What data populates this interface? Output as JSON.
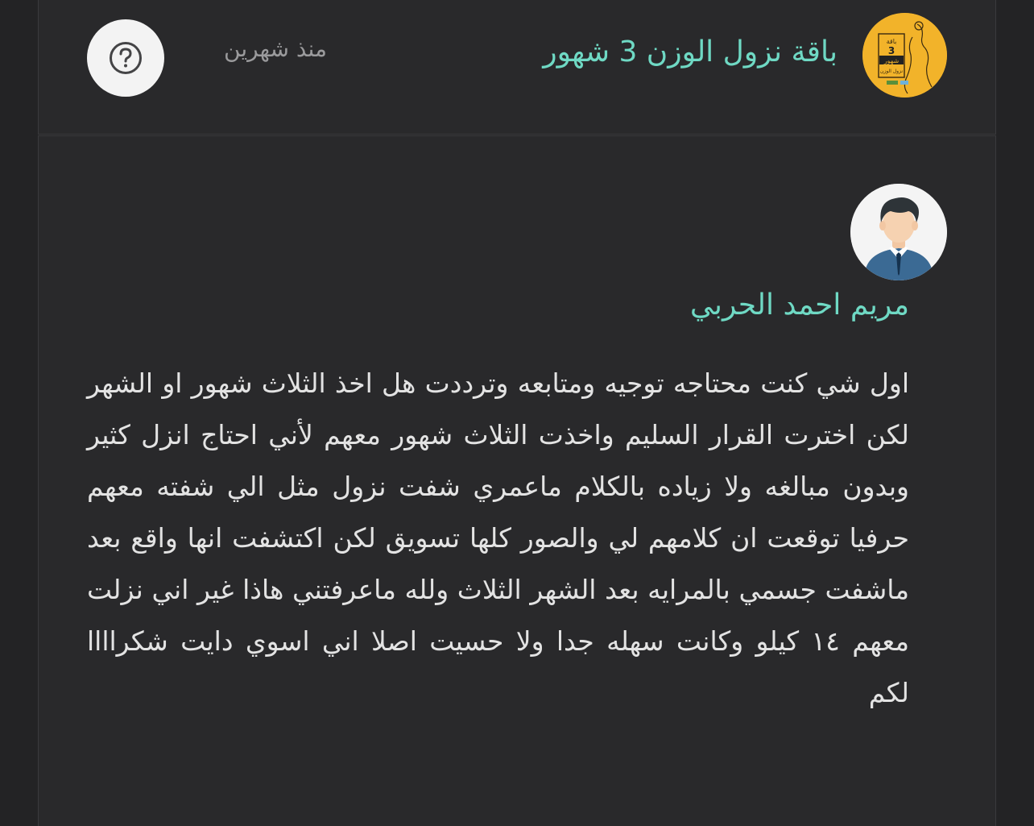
{
  "product": {
    "title": "باقة نزول الوزن 3 شهور",
    "thumbnail_icon": "product-package-image",
    "thumbnail_text": {
      "top": "باقة",
      "number": "3",
      "middle": "شهور",
      "bottom": "نزول الوزن"
    }
  },
  "meta": {
    "time_ago": "منذ شهرين"
  },
  "help": {
    "icon": "question-mark-icon",
    "glyph": "?"
  },
  "review": {
    "avatar_icon": "user-avatar-icon",
    "reviewer_name": "مريم احمد الحربي",
    "text": "اول شي كنت محتاجه توجيه ومتابعه وترددت هل اخذ الثلاث شهور او الشهر لكن اخترت القرار السليم واخذت الثلاث شهور معهم لأني احتاج انزل كثير وبدون مبالغه ولا زياده بالكلام ماعمري شفت نزول مثل الي شفته معهم حرفيا توقعت ان كلامهم لي والصور كلها تسويق لكن اكتشفت انها واقع بعد ماشفت جسمي بالمرايه بعد الشهر الثلاث ولله ماعرفتني هاذا غير اني نزلت معهم ١٤ كيلو وكانت سهله جدا ولا حسيت اصلا اني اسوي دايت شكراااا لكم"
  },
  "colors": {
    "background": "#232325",
    "card": "#29292b",
    "accent": "#6fd9c4",
    "thumbnail": "#f2b32a",
    "text": "#e3e3e3",
    "muted": "#9a9a9c"
  }
}
